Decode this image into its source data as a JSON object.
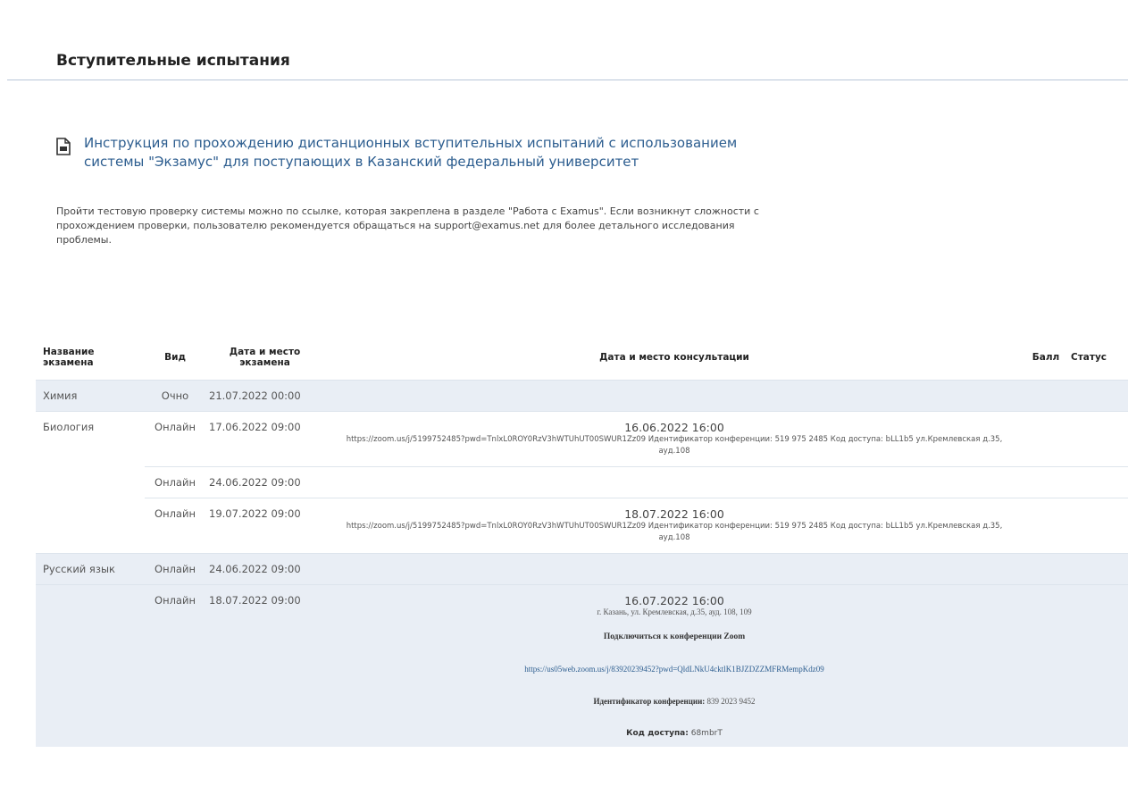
{
  "page": {
    "title": "Вступительные испытания"
  },
  "instruction": {
    "link_text": "Инструкция по прохождению дистанционных вступительных испытаний с использованием системы \"Экзамус\" для поступающих в Казанский федеральный университет",
    "icon": "document-icon",
    "note": "Пройти тестовую проверку системы можно по ссылке, которая закреплена в разделе \"Работа с Examus\". Если возникнут сложности с прохождением проверки, пользователю рекомендуется обращаться на support@examus.net для более детального исследования проблемы."
  },
  "table": {
    "headers": {
      "name": "Название экзамена",
      "type": "Вид",
      "date": "Дата и место экзамена",
      "consultation": "Дата и место консультации",
      "score": "Балл",
      "status": "Статус"
    },
    "rows": [
      {
        "name": "Химия",
        "type": "Очно",
        "date": "21.07.2022 00:00"
      },
      {
        "name": "Биология",
        "type": "Онлайн",
        "date": "17.06.2022 09:00",
        "cons_date": "16.06.2022 16:00",
        "cons_info": "https://zoom.us/j/5199752485?pwd=TnlxL0ROY0RzV3hWTUhUT00SWUR1Zz09 Идентификатор конференции: 519 975 2485 Код доступа: bLL1b5 ул.Кремлевская д.35, ауд.108"
      },
      {
        "type": "Онлайн",
        "date": "24.06.2022 09:00"
      },
      {
        "type": "Онлайн",
        "date": "19.07.2022 09:00",
        "cons_date": "18.07.2022 16:00",
        "cons_info": "https://zoom.us/j/5199752485?pwd=TnlxL0ROY0RzV3hWTUhUT00SWUR1Zz09 Идентификатор конференции: 519 975 2485 Код доступа: bLL1b5 ул.Кремлевская д.35, ауд.108"
      },
      {
        "name": "Русский язык",
        "type": "Онлайн",
        "date": "24.06.2022 09:00"
      },
      {
        "type": "Онлайн",
        "date": "18.07.2022 09:00",
        "cons_date": "16.07.2022 16:00",
        "cons_place": "г. Казань, ул. Кремлевская, д.35, ауд. 108, 109",
        "zoom_title": "Подключиться к конференции Zoom",
        "zoom_link": "https://us05web.zoom.us/j/83920239452?pwd=QldLNkU4cktlK1BJZDZZMFRMempKdz09",
        "conf_id_label": "Идентификатор конференции:",
        "conf_id_value": "839 2023 9452",
        "access_label": "Код доступа:",
        "access_value": "68mbrT"
      }
    ]
  }
}
